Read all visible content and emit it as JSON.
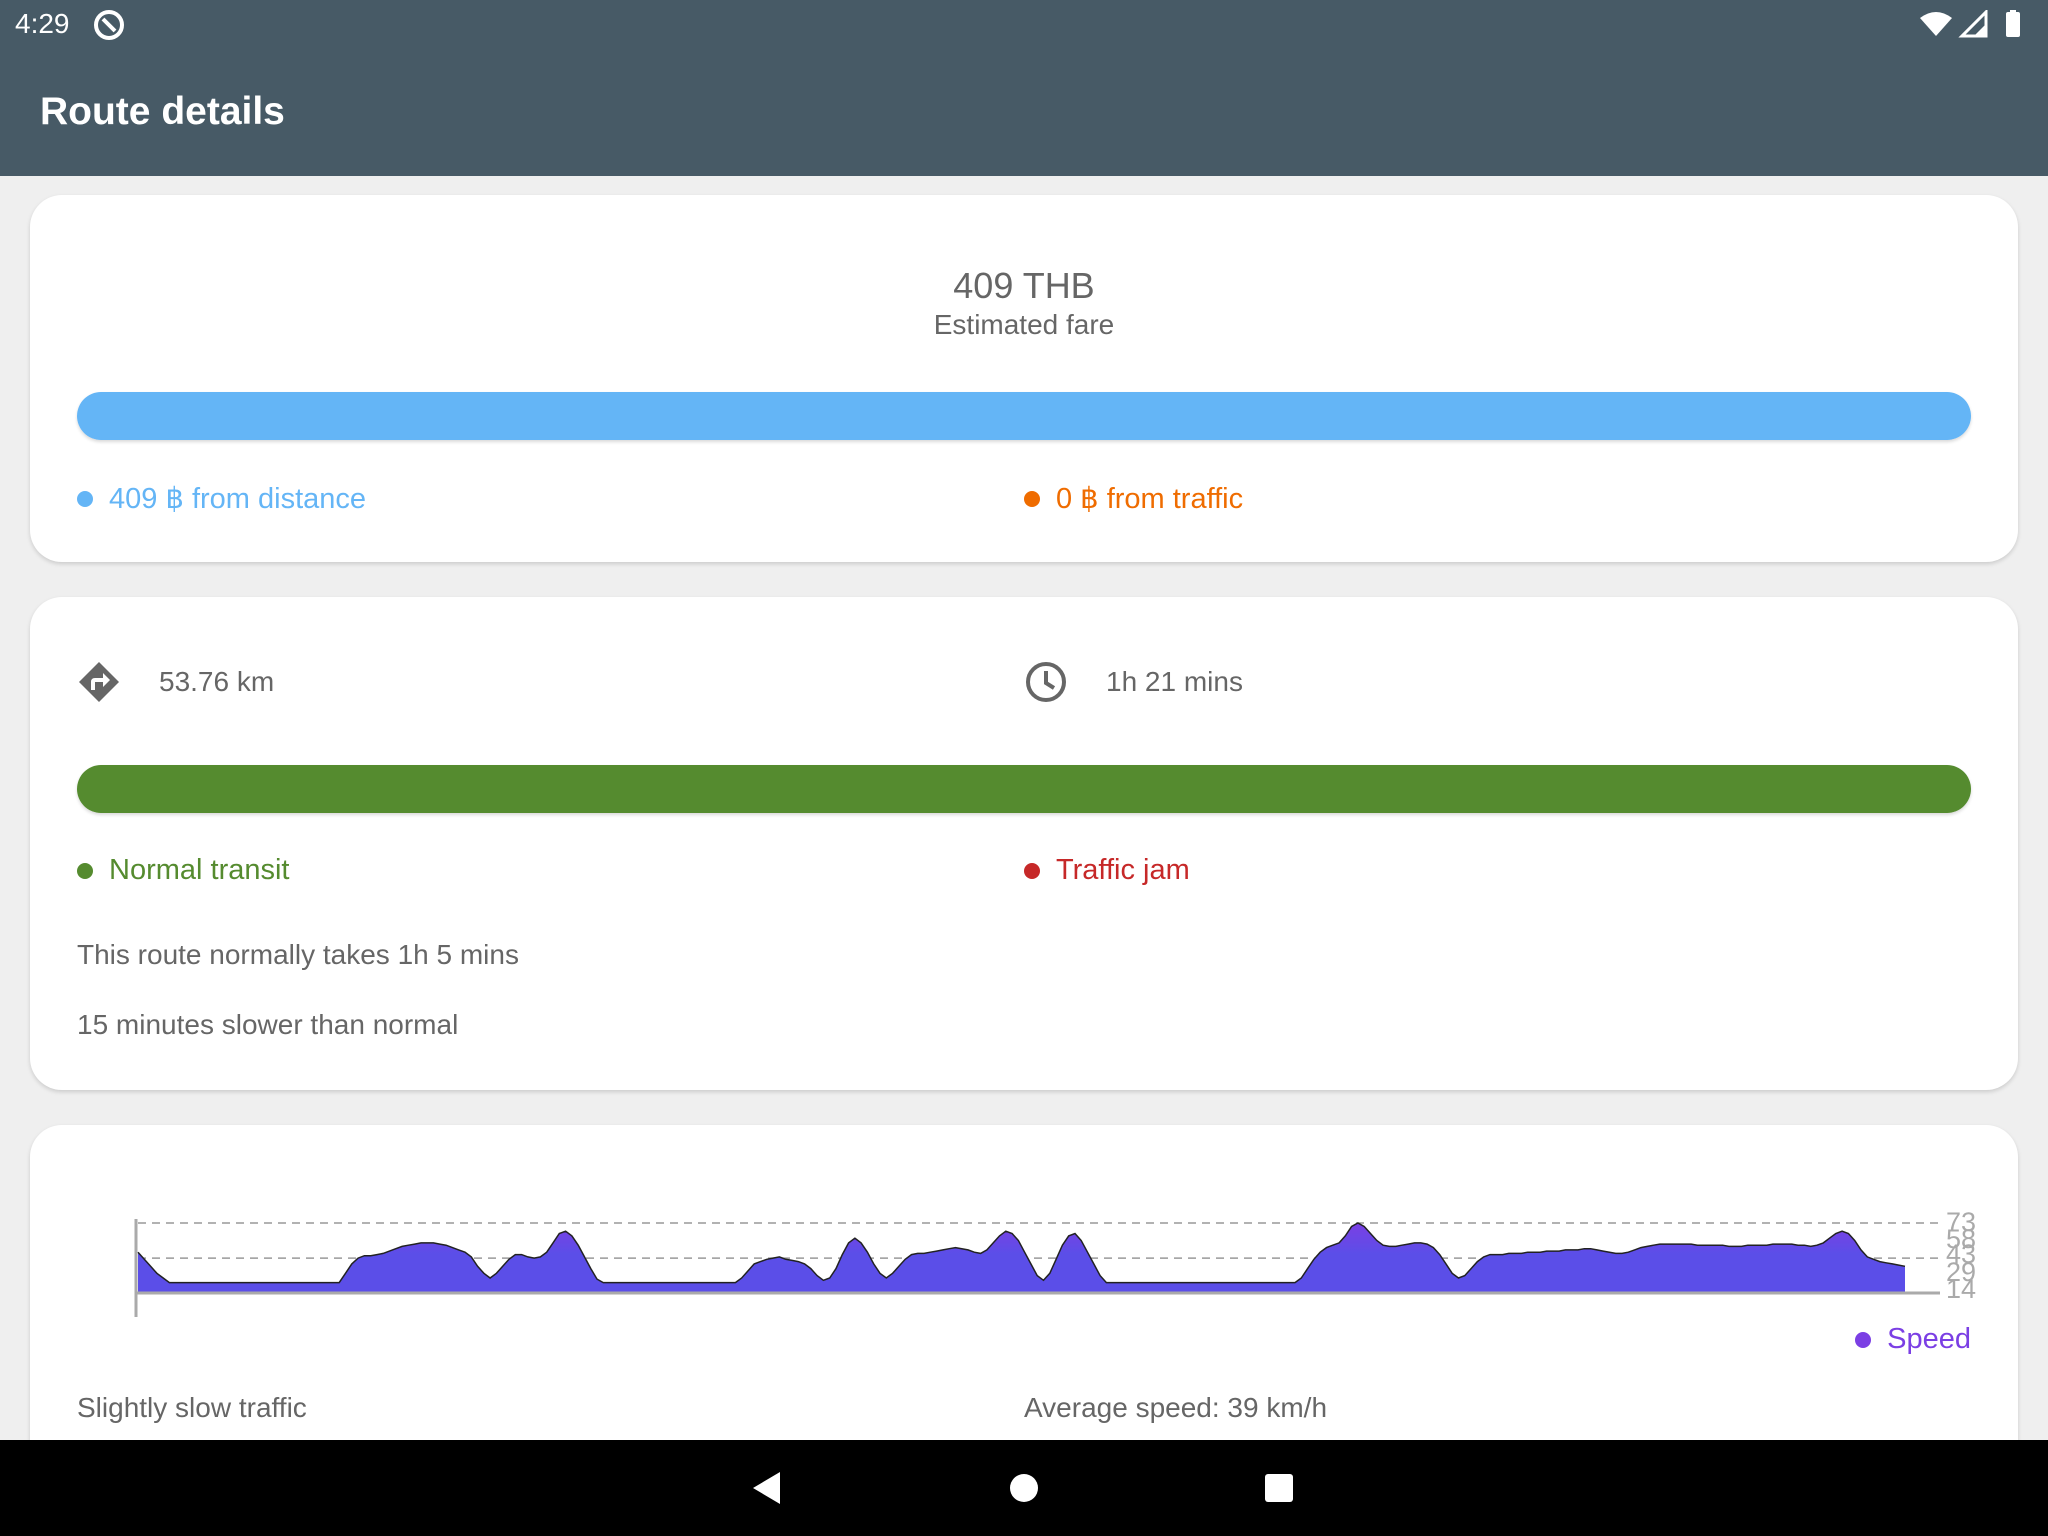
{
  "status_bar": {
    "time": "4:29"
  },
  "app_bar": {
    "title": "Route details"
  },
  "fare": {
    "value": "409 THB",
    "label": "Estimated fare",
    "breakdown": [
      {
        "label": "409 ฿ from distance",
        "color": "#64b5f6",
        "fraction": 1.0
      },
      {
        "label": "0 ฿ from traffic",
        "color": "#ef6c00",
        "fraction": 0.0
      }
    ]
  },
  "route": {
    "distance": "53.76 km",
    "duration": "1h 21 mins",
    "distance_icon": "directions-icon",
    "duration_icon": "clock-icon",
    "transit": [
      {
        "label": "Normal transit",
        "color": "#558b2f",
        "fraction": 1.0
      },
      {
        "label": "Traffic jam",
        "color": "#c62828",
        "fraction": 0.0
      }
    ],
    "normal_time_text": "This route normally takes 1h 5 mins",
    "delay_text": "15 minutes slower than normal"
  },
  "speed": {
    "legend_label": "Speed",
    "legend_color": "#7b3fe4",
    "fill_color": "#5b4ee8",
    "peak_color": "#7b3fe4",
    "traffic_label": "Slightly slow traffic",
    "average_text": "Average speed: 39 km/h"
  },
  "chart_data": {
    "type": "area",
    "series": [
      {
        "name": "Speed",
        "values": [
          48,
          42,
          36,
          30,
          26,
          22,
          22,
          22,
          22,
          22,
          22,
          22,
          22,
          22,
          22,
          22,
          22,
          22,
          22,
          22,
          22,
          22,
          22,
          22,
          22,
          22,
          22,
          22,
          22,
          22,
          22,
          22,
          22,
          30,
          38,
          43,
          45,
          45,
          46,
          47,
          49,
          51,
          53,
          54,
          55,
          56,
          56,
          56,
          55,
          54,
          52,
          50,
          48,
          44,
          36,
          30,
          26,
          30,
          36,
          42,
          46,
          46,
          44,
          43,
          44,
          48,
          56,
          64,
          66,
          62,
          54,
          44,
          34,
          25,
          22,
          22,
          22,
          22,
          22,
          22,
          22,
          22,
          22,
          22,
          22,
          22,
          22,
          22,
          22,
          22,
          22,
          22,
          22,
          22,
          22,
          22,
          26,
          32,
          38,
          40,
          42,
          43,
          44,
          42,
          41,
          40,
          38,
          34,
          28,
          24,
          26,
          34,
          46,
          56,
          60,
          56,
          48,
          38,
          30,
          26,
          30,
          36,
          42,
          46,
          47,
          47,
          48,
          49,
          50,
          51,
          52,
          51,
          50,
          48,
          47,
          50,
          56,
          62,
          66,
          64,
          58,
          48,
          38,
          28,
          24,
          30,
          42,
          54,
          62,
          64,
          58,
          48,
          38,
          28,
          22,
          22,
          22,
          22,
          22,
          22,
          22,
          22,
          22,
          22,
          22,
          22,
          22,
          22,
          22,
          22,
          22,
          22,
          22,
          22,
          22,
          22,
          22,
          22,
          22,
          22,
          22,
          22,
          22,
          22,
          22,
          26,
          34,
          42,
          48,
          52,
          54,
          56,
          62,
          70,
          73,
          70,
          64,
          58,
          54,
          53,
          53,
          54,
          55,
          56,
          56,
          55,
          52,
          46,
          38,
          30,
          26,
          28,
          34,
          40,
          44,
          46,
          46,
          46,
          47,
          47,
          47,
          48,
          48,
          48,
          49,
          49,
          49,
          50,
          50,
          50,
          51,
          51,
          50,
          49,
          48,
          47,
          47,
          48,
          50,
          52,
          53,
          54,
          55,
          55,
          55,
          55,
          55,
          55,
          54,
          54,
          54,
          54,
          54,
          53,
          53,
          53,
          54,
          54,
          54,
          54,
          55,
          55,
          55,
          55,
          54,
          54,
          53,
          54,
          56,
          60,
          64,
          66,
          64,
          58,
          50,
          44,
          42,
          40,
          39,
          38,
          37,
          36
        ]
      }
    ],
    "y_ticks": [
      "73",
      "58",
      "43",
      "29",
      "14"
    ],
    "ylim": [
      14,
      73
    ],
    "dashed_lines": [
      73,
      43
    ],
    "grid": false,
    "legend": "bottom-right"
  }
}
